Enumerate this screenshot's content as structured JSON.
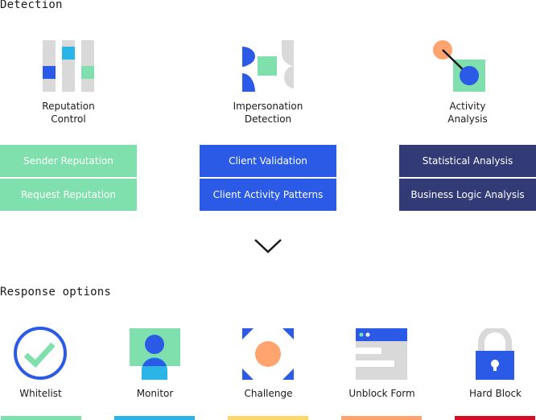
{
  "sections": {
    "detection_title": "Detection",
    "response_title": "Response options"
  },
  "detection": {
    "columns": [
      {
        "icon": "reputation-bars-icon",
        "label_line1": "Reputation",
        "label_line2": "Control",
        "color": "#7fe0ae",
        "text_color": "#ffffff",
        "items": [
          "Sender Reputation",
          "Request Reputation"
        ]
      },
      {
        "icon": "impersonation-shapes-icon",
        "label_line1": "Impersonation",
        "label_line2": "Detection",
        "color": "#2a5ae6",
        "items": [
          "Client Validation",
          "Client Activity Patterns"
        ]
      },
      {
        "icon": "activity-nodes-icon",
        "label_line1": "Activity",
        "label_line2": "Analysis",
        "color": "#323b75",
        "items": [
          "Statistical Analysis",
          "Business Logic Analysis"
        ]
      }
    ]
  },
  "arrow": {
    "icon": "chevron-down-icon"
  },
  "response": {
    "options": [
      {
        "label": "Whitelist",
        "icon": "check-circle-icon",
        "color": "#7fe0ae"
      },
      {
        "label": "Monitor",
        "icon": "person-monitor-icon",
        "color": "#2bb5e6"
      },
      {
        "label": "Challenge",
        "icon": "target-corners-icon",
        "color": "#ffd66b"
      },
      {
        "label": "Unblock Form",
        "icon": "form-window-icon",
        "color": "#ffa36f"
      },
      {
        "label": "Hard Block",
        "icon": "padlock-icon",
        "color": "#d50c22"
      }
    ]
  },
  "palette": {
    "green": "#7fe0ae",
    "blue": "#2a5ae6",
    "navy": "#323b75",
    "cyan": "#2bb5e6",
    "orange": "#ffa36f",
    "gray": "#d9d9d9",
    "red": "#d50c22",
    "yellow": "#ffd66b"
  }
}
